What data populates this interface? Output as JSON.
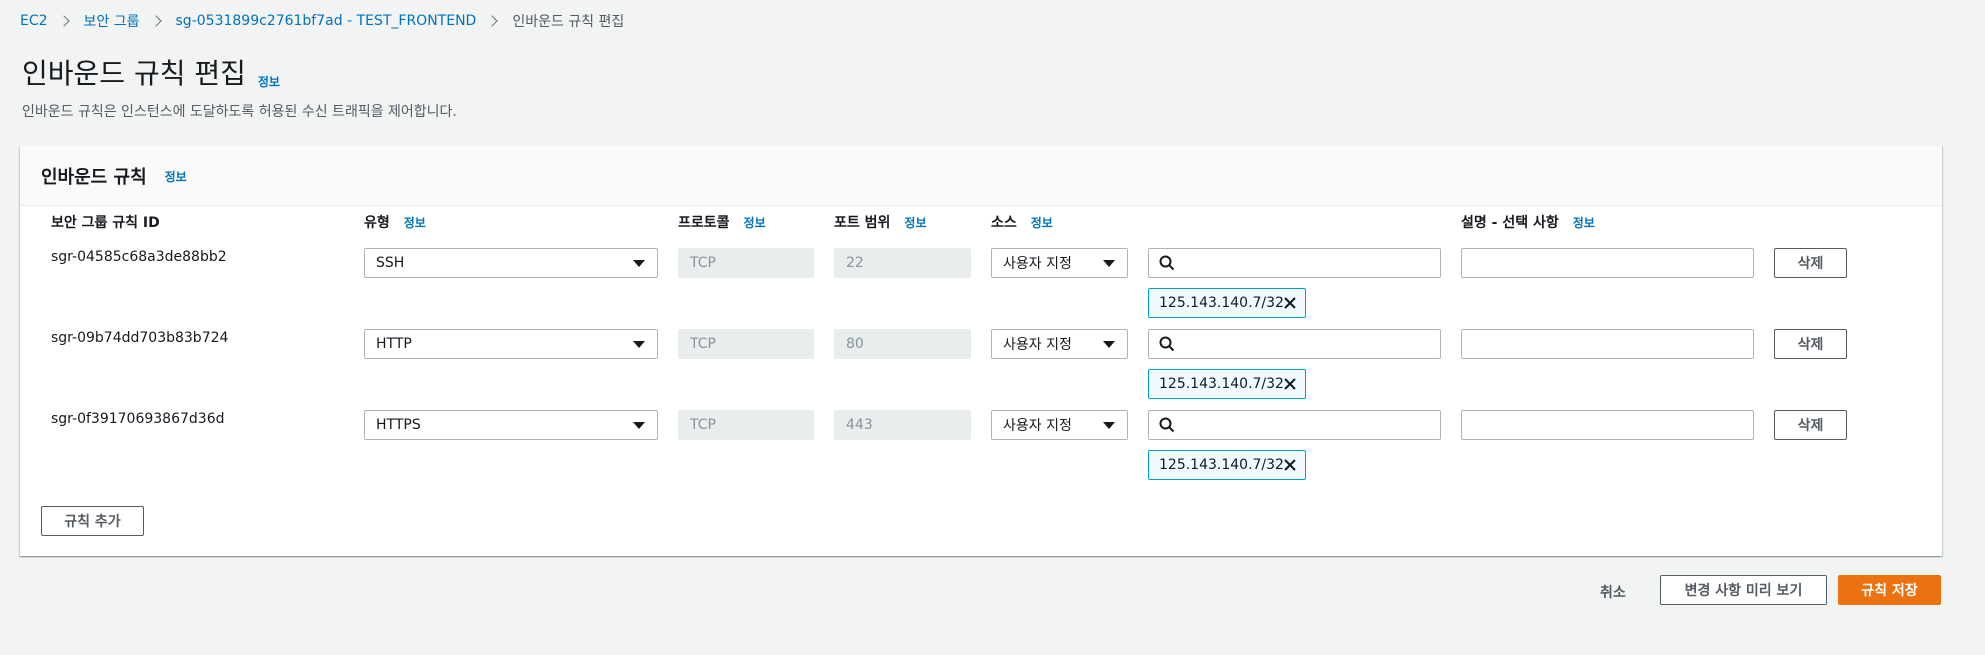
{
  "breadcrumb": {
    "items": [
      "EC2",
      "보안 그룹",
      "sg-0531899c2761bf7ad - TEST_FRONTEND",
      "인바운드 규칙 편집"
    ]
  },
  "page": {
    "title": "인바운드 규칙 편집",
    "info": "정보",
    "description": "인바운드 규칙은 인스턴스에 도달하도록 허용된 수신 트래픽을 제어합니다."
  },
  "panel": {
    "title": "인바운드 규칙",
    "info": "정보",
    "columns": {
      "rule_id": "보안 그룹 규칙 ID",
      "type": "유형",
      "protocol": "프로토콜",
      "port_range": "포트 범위",
      "source": "소스",
      "description": "설명 - 선택 사항",
      "info": "정보"
    },
    "rules": [
      {
        "id": "sgr-04585c68a3de88bb2",
        "type": "SSH",
        "protocol": "TCP",
        "port": "22",
        "source_type": "사용자 지정",
        "search_value": "",
        "cidr": "125.143.140.7/32",
        "description": "",
        "delete_label": "삭제"
      },
      {
        "id": "sgr-09b74dd703b83b724",
        "type": "HTTP",
        "protocol": "TCP",
        "port": "80",
        "source_type": "사용자 지정",
        "search_value": "",
        "cidr": "125.143.140.7/32",
        "description": "",
        "delete_label": "삭제"
      },
      {
        "id": "sgr-0f39170693867d36d",
        "type": "HTTPS",
        "protocol": "TCP",
        "port": "443",
        "source_type": "사용자 지정",
        "search_value": "",
        "cidr": "125.143.140.7/32",
        "description": "",
        "delete_label": "삭제"
      }
    ],
    "add_rule_label": "규칙 추가"
  },
  "footer": {
    "cancel_label": "취소",
    "preview_label": "변경 사항 미리 보기",
    "save_label": "규칙 저장"
  },
  "colors": {
    "link": "#0073bb",
    "primary": "#ec7211",
    "token_border": "#00a1c9",
    "background": "#f2f3f3"
  }
}
